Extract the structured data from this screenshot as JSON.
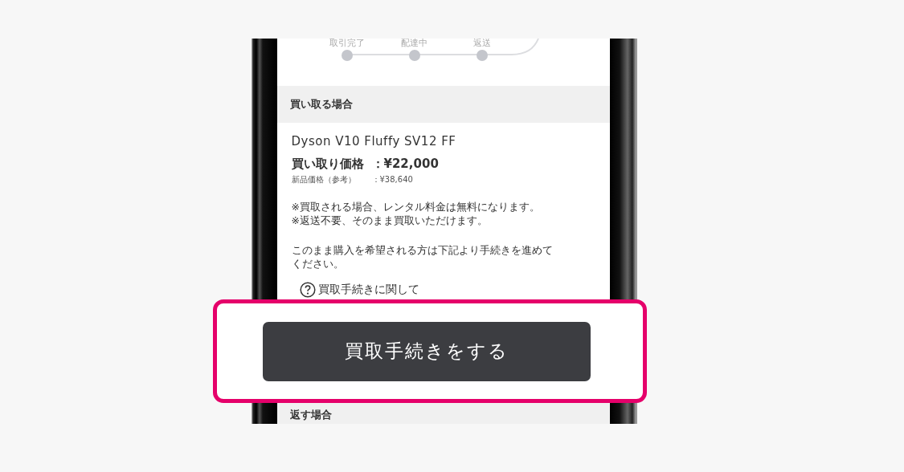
{
  "steps": [
    {
      "label": "取引完了"
    },
    {
      "label": "配達中"
    },
    {
      "label": "返送"
    }
  ],
  "buy_section": {
    "heading": "買い取る場合",
    "product": "Dyson V10 Fluffy SV12 FF",
    "price_label": "買い取り価格",
    "price_value": "：¥22,000",
    "retail_label": "新品価格（参考）",
    "retail_value": "：¥38,640",
    "notes": [
      "※買取される場合、レンタル料金は無料になります。",
      "※返送不要、そのまま買取いただけます。"
    ],
    "instruction": "このまま購入を希望される方は下記より手続きを進めてください。",
    "help_link": "買取手続きに関して"
  },
  "highlight": {
    "button": "買取手続きをする"
  },
  "return_section": {
    "heading": "返す場合"
  }
}
